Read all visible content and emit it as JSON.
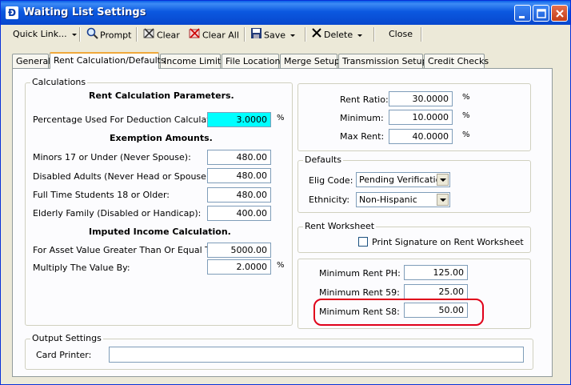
{
  "window": {
    "title": "Waiting List Settings"
  },
  "toolbar": {
    "quick_link": "Quick Link...",
    "prompt": "Prompt",
    "clear": "Clear",
    "clear_all": "Clear All",
    "save": "Save",
    "delete": "Delete",
    "close": "Close"
  },
  "tabs": [
    "General",
    "Rent Calculation/Defaults",
    "Income Limits",
    "File Locations",
    "Merge Setup",
    "Transmission Setup",
    "Credit Checks"
  ],
  "active_tab": "Rent Calculation/Defaults",
  "calculations": {
    "legend": "Calculations",
    "rent_params_header": "Rent Calculation Parameters.",
    "pct_deduction_label": "Percentage Used For Deduction Calculation:",
    "pct_deduction_value": "3.0000",
    "pct_symbol": "%",
    "exemption_header": "Exemption Amounts.",
    "minors_label": "Minors 17 or Under (Never Spouse):",
    "minors_value": "480.00",
    "disabled_label": "Disabled Adults (Never Head or Spouse):",
    "disabled_value": "480.00",
    "students_label": "Full Time Students 18 or Older:",
    "students_value": "480.00",
    "elderly_label": "Elderly Family (Disabled or Handicap):",
    "elderly_value": "400.00",
    "imputed_header": "Imputed Income Calculation.",
    "asset_label": "For Asset Value Greater Than Or Equal To:",
    "asset_value": "5000.00",
    "multiply_label": "Multiply The Value By:",
    "multiply_value": "2.0000"
  },
  "rent": {
    "ratio_label": "Rent Ratio:",
    "ratio_value": "30.0000",
    "minimum_label": "Minimum:",
    "minimum_value": "10.0000",
    "max_label": "Max Rent:",
    "max_value": "40.0000",
    "pct_symbol": "%"
  },
  "defaults": {
    "legend": "Defaults",
    "elig_label": "Elig Code:",
    "elig_value": "Pending Verification",
    "ethnicity_label": "Ethnicity:",
    "ethnicity_value": "Non-Hispanic"
  },
  "worksheet": {
    "legend": "Rent Worksheet",
    "print_signature_label": "Print Signature on Rent Worksheet",
    "print_signature_checked": false
  },
  "minimum_rent": {
    "ph_label": "Minimum Rent PH:",
    "ph_value": "125.00",
    "s9_label": "Minimum Rent 59:",
    "s9_value": "25.00",
    "s8_label": "Minimum Rent S8:",
    "s8_value": "50.00"
  },
  "output": {
    "legend": "Output Settings",
    "card_printer_label": "Card Printer:",
    "card_printer_value": ""
  },
  "colors": {
    "highlight_field": "#00ffff",
    "annotation": "#e0001a",
    "titlebar": "#0747cd"
  }
}
